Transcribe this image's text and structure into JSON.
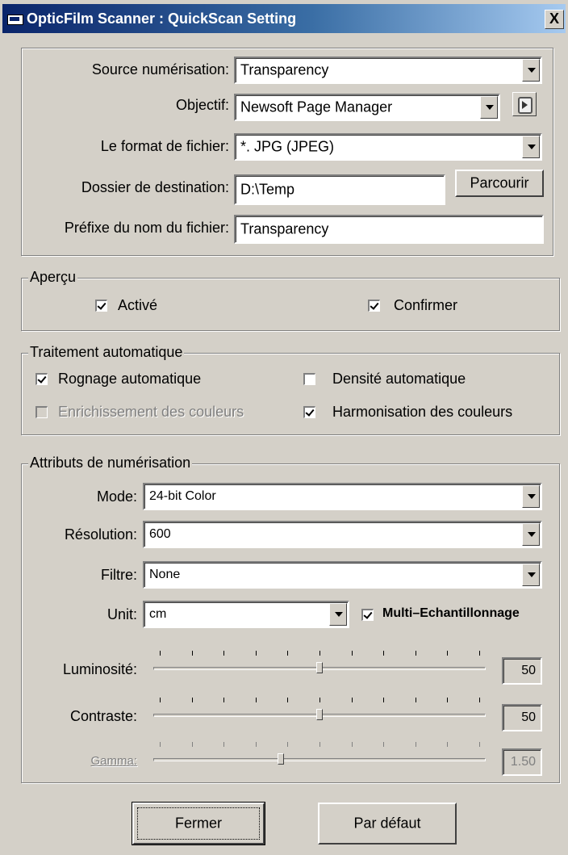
{
  "window": {
    "title": "OpticFilm Scanner : QuickScan Setting",
    "close_glyph": "X"
  },
  "general": {
    "source": {
      "label": "Source numérisation:",
      "value": "Transparency"
    },
    "objective": {
      "label": "Objectif:",
      "value": "Newsoft Page Manager",
      "icon": "destination-app-icon"
    },
    "file_format": {
      "label": "Le format de fichier:",
      "value": "*. JPG (JPEG)"
    },
    "dest_folder": {
      "label": "Dossier de destination:",
      "value": "D:\\Temp",
      "browse_label": "Parcourir"
    },
    "file_prefix": {
      "label": "Préfixe du nom du fichier:",
      "value": "Transparency"
    }
  },
  "preview": {
    "title": "Aperçu",
    "enabled": {
      "label": "Activé",
      "checked": true
    },
    "confirm": {
      "label": "Confirmer",
      "checked": true
    }
  },
  "auto": {
    "title": "Traitement automatique",
    "crop": {
      "label": "Rognage automatique",
      "checked": true
    },
    "density": {
      "label": "Densité automatique",
      "checked": false
    },
    "enrich": {
      "label": "Enrichissement des couleurs",
      "checked": false,
      "disabled": true
    },
    "harmony": {
      "label": "Harmonisation des couleurs",
      "checked": true
    }
  },
  "scan": {
    "title": "Attributs de numérisation",
    "mode": {
      "label": "Mode:",
      "value": "24-bit Color"
    },
    "resolution": {
      "label": "Résolution:",
      "value": "600"
    },
    "filter": {
      "label": "Filtre:",
      "value": "None"
    },
    "unit": {
      "label": "Unit:",
      "value": "cm"
    },
    "multisample": {
      "label": "Multi–Echantillonnage",
      "checked": true
    },
    "brightness": {
      "label": "Luminosité:",
      "value": "50",
      "fraction": 0.5
    },
    "contrast": {
      "label": "Contraste:",
      "value": "50",
      "fraction": 0.5
    },
    "gamma": {
      "label": "Gamma:",
      "value": "1.50",
      "fraction": 0.38,
      "disabled": true
    }
  },
  "buttons": {
    "close": "Fermer",
    "default": "Par défaut"
  }
}
